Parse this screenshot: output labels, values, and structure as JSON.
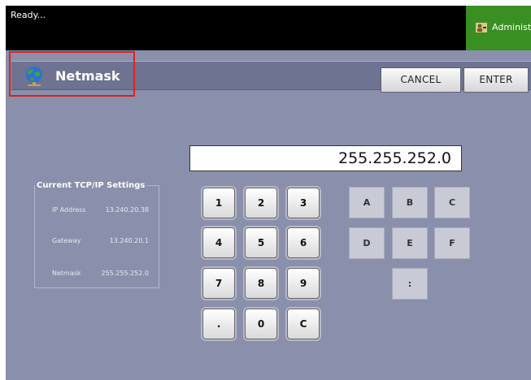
{
  "status": {
    "text": "Ready..."
  },
  "admin": {
    "label": "Administr"
  },
  "header": {
    "title": "Netmask",
    "cancel_label": "CANCEL",
    "enter_label": "ENTER",
    "icon": "globe-network-icon",
    "highlight_color": "#e0201c"
  },
  "entry": {
    "value": "255.255.252.0"
  },
  "settings": {
    "title": "Current TCP/IP Settings",
    "rows": [
      {
        "label": "IP Address",
        "value": "13.240.20.38"
      },
      {
        "label": "Gateway",
        "value": "13.240.20.1"
      },
      {
        "label": "Netmask",
        "value": "255.255.252.0"
      }
    ]
  },
  "keypad": {
    "digits": [
      "1",
      "2",
      "3",
      "4",
      "5",
      "6",
      "7",
      "8",
      "9",
      ".",
      "0",
      "C"
    ]
  },
  "hexpad": {
    "keys": [
      "A",
      "B",
      "C",
      "D",
      "E",
      "F",
      ":"
    ]
  },
  "colors": {
    "panel": "#8a8fab",
    "titlebar": "#6e7392",
    "admin_green": "#3a8f22"
  }
}
